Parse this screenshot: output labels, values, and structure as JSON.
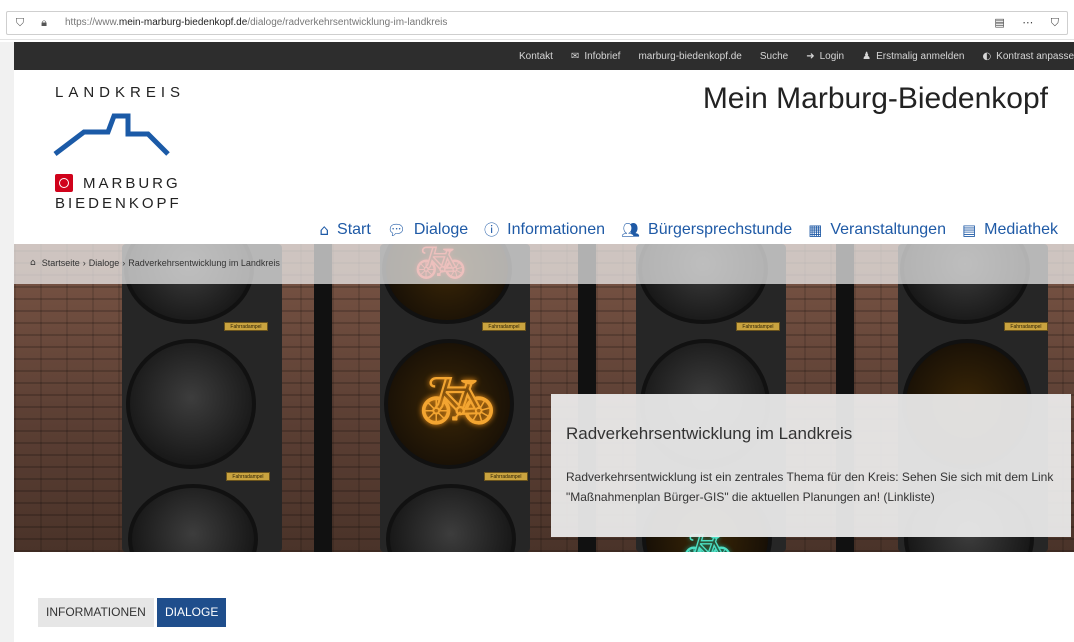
{
  "browser": {
    "url_prefix": "https://www.",
    "url_domain": "mein-marburg-biedenkopf.de",
    "url_path": "/dialoge/radverkehrsentwicklung-im-landkreis"
  },
  "topnav": {
    "items": [
      "Kontakt",
      "Infobrief",
      "marburg-biedenkopf.de",
      "Suche",
      "Login",
      "Erstmalig anmelden",
      "Kontrast anpasse"
    ]
  },
  "logo": {
    "line1": "LANDKREIS",
    "line2": "MARBURG",
    "line3": "BIEDENKOPF"
  },
  "site_title": "Mein Marburg-Biedenkopf",
  "mainnav": {
    "items": [
      "Start",
      "Dialoge",
      "Informationen",
      "Bürgersprechstunde",
      "Veranstaltungen",
      "Mediathek"
    ]
  },
  "breadcrumb": {
    "items": [
      "Startseite",
      "Dialoge",
      "Radverkehrsentwicklung im Landkreis"
    ],
    "separator": "›"
  },
  "hero": {
    "title": "Radverkehrsentwicklung im Landkreis",
    "text": "Radverkehrsentwicklung ist ein zentrales Thema für den Kreis: Sehen Sie sich mit dem Link \"Maßnahmenplan Bürger-GIS\" die aktuellen Planungen an! (Linkliste)"
  },
  "tabs": {
    "info": "INFORMATIONEN",
    "dialog": "DIALOGE"
  },
  "colors": {
    "topbar": "#2d2d2d",
    "nav_blue": "#1f5aa6",
    "tab_active": "#1f4e8c",
    "logo_red": "#d0021b",
    "logo_blue": "#1b5aa7"
  }
}
